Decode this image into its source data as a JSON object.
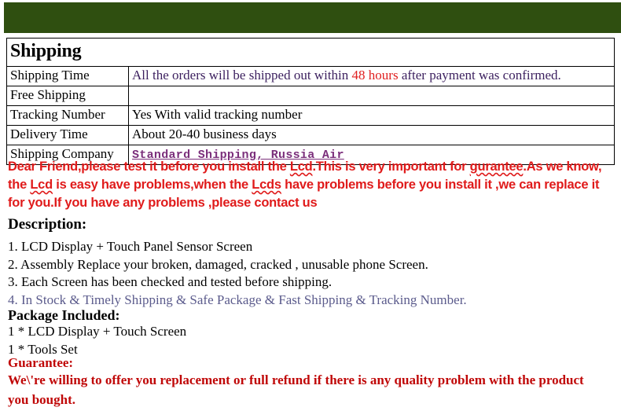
{
  "banner": {
    "color": "#2f4f10",
    "label": "green-banner"
  },
  "shipping_table": {
    "heading": "Shipping",
    "rows": [
      {
        "label": "Shipping Time",
        "value_parts": [
          {
            "text": "All the orders will be shipped out within ",
            "color": "#3b1f5e"
          },
          {
            "text": "48 hours",
            "color": "#e02020"
          },
          {
            "text": " after payment was confirmed.",
            "color": "#3b1f5e"
          }
        ]
      },
      {
        "label": "Free Shipping",
        "value": ""
      },
      {
        "label": "Tracking Number",
        "value": "Yes With valid tracking number"
      },
      {
        "label": "Delivery Time",
        "value": "About 20-40 business days"
      },
      {
        "label": "Shipping Company",
        "value": "Standard Shipping, Russia Air"
      }
    ]
  },
  "warning": {
    "line1_a": "Dear Friend,please test it before you install the ",
    "line1_b": "Lcd",
    "line1_c": ".This is very important for ",
    "line1_d": "gurantee",
    "line1_e": ".As we know, the ",
    "line1_f": "Lcd",
    "line1_g": " is easy have problems,when the ",
    "line1_h": "Lcds",
    "line1_i": " have problems before you install it ,we can replace it for you.If you have any problems ,please contact us",
    "color": "#e01b1b"
  },
  "description": {
    "heading": "Description:",
    "items": [
      "1. LCD Display + Touch Panel Sensor Screen",
      "2. Assembly Replace your broken, damaged, cracked , unusable phone Screen.",
      "3. Each Screen has been checked and tested before shipping.",
      "4. In Stock & Timely Shipping & Safe Package & Fast Shipping & Tracking Number."
    ]
  },
  "package": {
    "heading": "Package Included:",
    "items": [
      "1 * LCD Display + Touch Screen",
      "1 * Tools Set"
    ]
  },
  "guarantee": {
    "heading": "Guarantee:",
    "body": "We\\'re willing to offer you replacement or full refund if there is any quality problem with the product you bought.",
    "color": "#c00808"
  }
}
